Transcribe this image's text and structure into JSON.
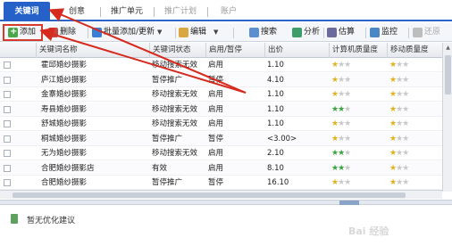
{
  "tabs": [
    {
      "label": "关键词",
      "active": true
    },
    {
      "label": "创意"
    },
    {
      "label": "推广单元"
    },
    {
      "label": "推广计划",
      "disabled": true
    },
    {
      "label": "账户",
      "disabled": true
    }
  ],
  "toolbar": {
    "add": "添加",
    "delete": "删除",
    "batch": "批量添加/更新",
    "edit": "编辑",
    "search": "搜索",
    "analyze": "分析",
    "estimate": "估算",
    "monitor": "监控",
    "restore": "还原"
  },
  "table": {
    "headers": [
      "关键词名称",
      "关键词状态",
      "启用/暂停",
      "出价",
      "计算机质量度",
      "移动质量度"
    ],
    "rows": [
      {
        "name": "霍邱婚纱摄影",
        "status": "移动搜索无效",
        "enable": "启用",
        "bid": "1.10",
        "pc": 1,
        "pc_color": "y",
        "mobile": 1
      },
      {
        "name": "庐江婚纱摄影",
        "status": "暂停推广",
        "enable": "暂停",
        "bid": "4.10",
        "pc": 1,
        "pc_color": "y",
        "mobile": 1
      },
      {
        "name": "金寨婚纱摄影",
        "status": "移动搜索无效",
        "enable": "启用",
        "bid": "1.10",
        "pc": 1,
        "pc_color": "y",
        "mobile": 1
      },
      {
        "name": "寿县婚纱摄影",
        "status": "移动搜索无效",
        "enable": "启用",
        "bid": "1.10",
        "pc": 2,
        "pc_color": "g",
        "mobile": 1
      },
      {
        "name": "舒城婚纱摄影",
        "status": "移动搜索无效",
        "enable": "启用",
        "bid": "1.10",
        "pc": 1,
        "pc_color": "y",
        "mobile": 1
      },
      {
        "name": "桐城婚纱摄影",
        "status": "暂停推广",
        "enable": "暂停",
        "bid": "<3.00>",
        "pc": 1,
        "pc_color": "y",
        "mobile": 1
      },
      {
        "name": "无为婚纱摄影",
        "status": "移动搜索无效",
        "enable": "启用",
        "bid": "2.10",
        "pc": 2,
        "pc_color": "g",
        "mobile": 1
      },
      {
        "name": "合肥婚纱摄影店",
        "status": "有效",
        "enable": "启用",
        "bid": "8.10",
        "pc": 2,
        "pc_color": "g",
        "mobile": 1
      },
      {
        "name": "合肥婚纱摄影",
        "status": "暂停推广",
        "enable": "暂停",
        "bid": "16.10",
        "pc": 1,
        "pc_color": "y",
        "mobile": 1
      }
    ]
  },
  "bottom": {
    "tip": "暂无优化建议"
  },
  "watermark": "Bai 经验",
  "colors": {
    "accent": "#2561c9",
    "highlight": "#d43b2f"
  }
}
